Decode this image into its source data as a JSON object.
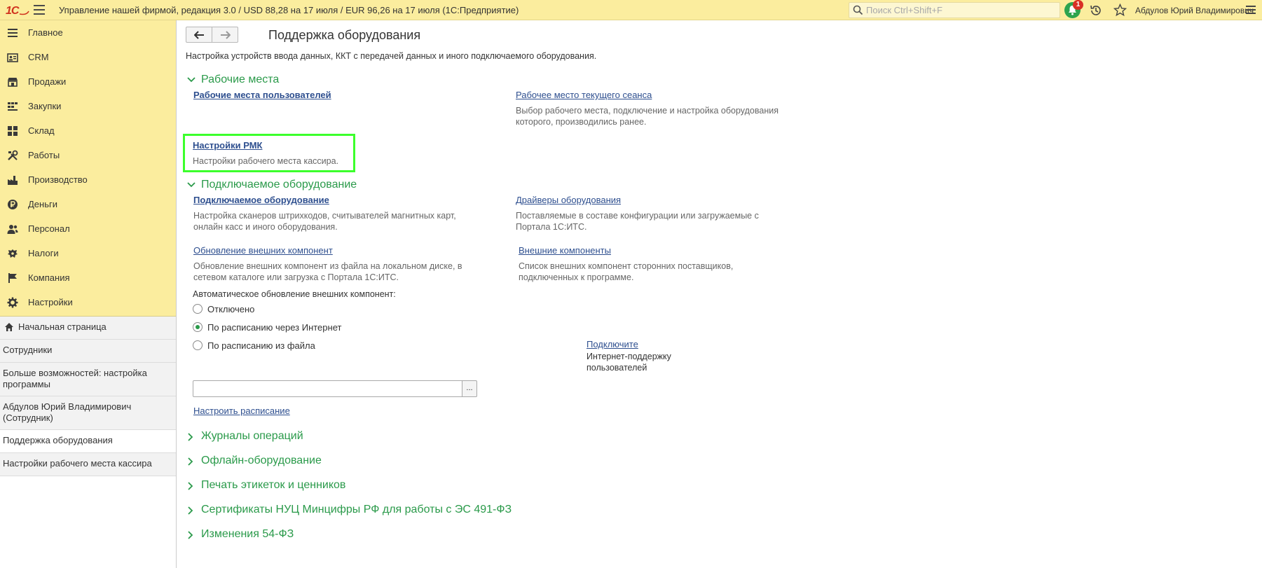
{
  "topbar": {
    "logo": "1С",
    "title": "Управление нашей фирмой, редакция 3.0 / USD 88,28 на 17 июля / EUR 96,26 на 17 июля  (1С:Предприятие)",
    "search_placeholder": "Поиск Ctrl+Shift+F",
    "notifications_count": "1",
    "user": "Абдулов Юрий Владимирович"
  },
  "sidebar": {
    "sections": [
      {
        "label": "Главное",
        "icon": "menu-list-icon"
      },
      {
        "label": "CRM",
        "icon": "contact-card-icon"
      },
      {
        "label": "Продажи",
        "icon": "shop-icon"
      },
      {
        "label": "Закупки",
        "icon": "purchases-icon"
      },
      {
        "label": "Склад",
        "icon": "warehouse-icon"
      },
      {
        "label": "Работы",
        "icon": "tools-icon"
      },
      {
        "label": "Производство",
        "icon": "factory-icon"
      },
      {
        "label": "Деньги",
        "icon": "ruble-coin-icon"
      },
      {
        "label": "Персонал",
        "icon": "people-icon"
      },
      {
        "label": "Налоги",
        "icon": "emblem-icon"
      },
      {
        "label": "Компания",
        "icon": "flag-icon"
      },
      {
        "label": "Настройки",
        "icon": "gear-icon"
      }
    ],
    "open_windows": [
      {
        "label": "Начальная страница"
      },
      {
        "label": "Сотрудники"
      },
      {
        "label": "Больше возможностей: настройка программы"
      },
      {
        "label": "Абдулов Юрий Владимирович (Сотрудник)"
      },
      {
        "label": "Поддержка оборудования"
      },
      {
        "label": "Настройки рабочего места кассира"
      }
    ]
  },
  "main": {
    "title": "Поддержка оборудования",
    "description": "Настройка устройств ввода данных, ККТ с передачей данных и иного подключаемого оборудования.",
    "workplaces": {
      "title": "Рабочие места",
      "user_workplaces": "Рабочие места пользователей",
      "current_session": "Рабочее место текущего сеанса",
      "current_session_note_1": "Выбор рабочего места, подключение и настройка оборудования",
      "current_session_note_2": "которого, производились ранее.",
      "rmk_settings": "Настройки РМК",
      "rmk_note": "Настройки рабочего места кассира."
    },
    "equipment": {
      "title": "Подключаемое оборудование",
      "connected": "Подключаемое оборудование",
      "connected_note_1": "Настройка сканеров штрихкодов, считывателей магнитных карт,",
      "connected_note_2": "онлайн касс и иного оборудования.",
      "drivers": "Драйверы оборудования",
      "drivers_note_1": "Поставляемые в составе конфигурации или загружаемые с",
      "drivers_note_2": "Портала 1С:ИТС.",
      "update_components": "Обновление внешних компонент",
      "update_note_1": "Обновление внешних компонент из файла на локальном диске, в",
      "update_note_2": "сетевом каталоге или загрузка с Портала 1С:ИТС.",
      "external_components": "Внешние компоненты",
      "external_note_1": "Список внешних компонент сторонних поставщиков,",
      "external_note_2": "подключенных к программе.",
      "auto_update_label": "Автоматическое обновление внешних компонент:",
      "options": [
        "Отключено",
        "По расписанию через Интернет",
        "По расписанию из файла"
      ],
      "selected_option": "По расписанию через Интернет",
      "connect_link": "Подключите",
      "connect_note_1": "Интернет-поддержку",
      "connect_note_2": "пользователей",
      "file_path_value": "",
      "browse_label": "...",
      "schedule_link": "Настроить расписание"
    },
    "collapsed_groups": [
      "Журналы операций",
      "Офлайн-оборудование",
      "Печать этикеток и ценников",
      "Сертификаты НУЦ Минцифры РФ для работы с ЭС 491-ФЗ",
      "Изменения 54-ФЗ"
    ]
  },
  "colors": {
    "topbar_bg": "#fbed9e",
    "group_title": "#2a9a4a",
    "link": "#2e4f8f",
    "highlight": "#3cff2c",
    "bell": "#2da44e",
    "badge": "#d93025"
  }
}
